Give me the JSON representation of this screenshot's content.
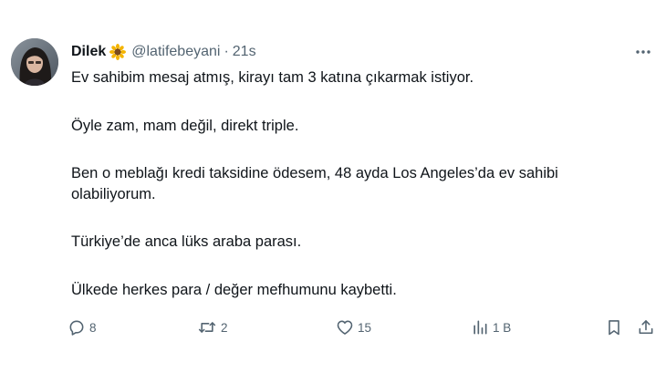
{
  "author": {
    "display_name": "Dilek",
    "emoji_icon": "sunflower-icon",
    "handle": "@latifebeyani",
    "separator": "·",
    "time": "21s"
  },
  "tweet_text": {
    "p1": "Ev sahibim mesaj atmış, kirayı tam 3 katına çıkarmak istiyor.",
    "p2": "Öyle zam, mam değil, direkt triple.",
    "p3": "Ben o meblağı kredi taksidine ödesem, 48 ayda Los Angeles’da ev sahibi olabiliyorum.",
    "p4": "Türkiye’de anca lüks araba parası.",
    "p5": "Ülkede herkes para / değer mefhumunu kaybetti."
  },
  "actions": {
    "reply_count": "8",
    "retweet_count": "2",
    "like_count": "15",
    "views_count": "1 B"
  },
  "colors": {
    "text": "#0f1419",
    "secondary": "#536471",
    "background": "#ffffff"
  }
}
